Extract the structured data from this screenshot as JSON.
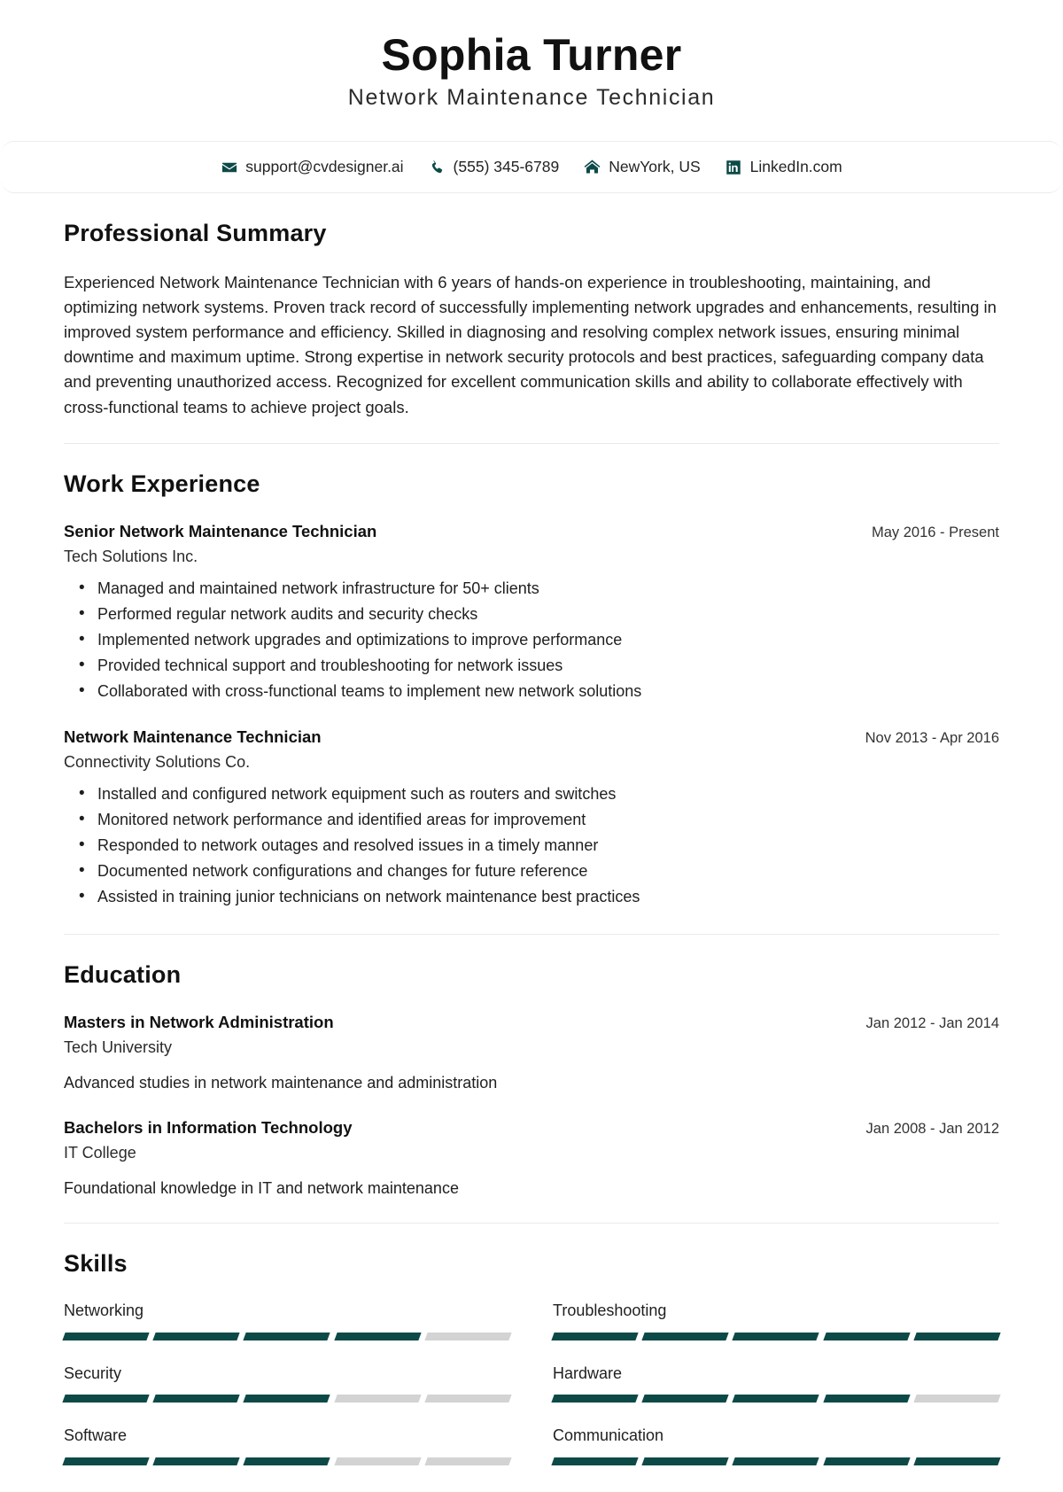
{
  "header": {
    "name": "Sophia Turner",
    "title": "Network Maintenance Technician"
  },
  "contact": {
    "items": [
      {
        "icon": "envelope-icon",
        "label": "support@cvdesigner.ai"
      },
      {
        "icon": "phone-icon",
        "label": "(555) 345-6789"
      },
      {
        "icon": "home-icon",
        "label": "NewYork, US"
      },
      {
        "icon": "linkedin-icon",
        "label": "LinkedIn.com"
      }
    ]
  },
  "sections": {
    "summary": {
      "title": "Professional Summary",
      "text": "Experienced Network Maintenance Technician with 6 years of hands-on experience in troubleshooting, maintaining, and optimizing network systems. Proven track record of successfully implementing network upgrades and enhancements, resulting in improved system performance and efficiency. Skilled in diagnosing and resolving complex network issues, ensuring minimal downtime and maximum uptime. Strong expertise in network security protocols and best practices, safeguarding company data and preventing unauthorized access. Recognized for excellent communication skills and ability to collaborate effectively with cross-functional teams to achieve project goals."
    },
    "experience": {
      "title": "Work Experience",
      "entries": [
        {
          "title": "Senior Network Maintenance Technician",
          "company": "Tech Solutions Inc.",
          "date": "May 2016 - Present",
          "bullets": [
            "Managed and maintained network infrastructure for 50+ clients",
            "Performed regular network audits and security checks",
            "Implemented network upgrades and optimizations to improve performance",
            "Provided technical support and troubleshooting for network issues",
            "Collaborated with cross-functional teams to implement new network solutions"
          ]
        },
        {
          "title": "Network Maintenance Technician",
          "company": "Connectivity Solutions Co.",
          "date": "Nov 2013 - Apr 2016",
          "bullets": [
            "Installed and configured network equipment such as routers and switches",
            "Monitored network performance and identified areas for improvement",
            "Responded to network outages and resolved issues in a timely manner",
            "Documented network configurations and changes for future reference",
            "Assisted in training junior technicians on network maintenance best practices"
          ]
        }
      ]
    },
    "education": {
      "title": "Education",
      "entries": [
        {
          "degree": "Masters in Network Administration",
          "school": "Tech University",
          "date": "Jan 2012 - Jan 2014",
          "description": "Advanced studies in network maintenance and administration"
        },
        {
          "degree": "Bachelors in Information Technology",
          "school": "IT College",
          "date": "Jan 2008 - Jan 2012",
          "description": "Foundational knowledge in IT and network maintenance"
        }
      ]
    },
    "skills": {
      "title": "Skills",
      "max_level": 5,
      "items": [
        {
          "name": "Networking",
          "level": 4
        },
        {
          "name": "Troubleshooting",
          "level": 5
        },
        {
          "name": "Security",
          "level": 3
        },
        {
          "name": "Hardware",
          "level": 4
        },
        {
          "name": "Software",
          "level": 3
        },
        {
          "name": "Communication",
          "level": 5
        }
      ]
    }
  },
  "colors": {
    "accent": "#0d4a47",
    "skill_empty": "#d3d3d3",
    "text": "#1a1a1a",
    "divider": "#e9eaea"
  }
}
